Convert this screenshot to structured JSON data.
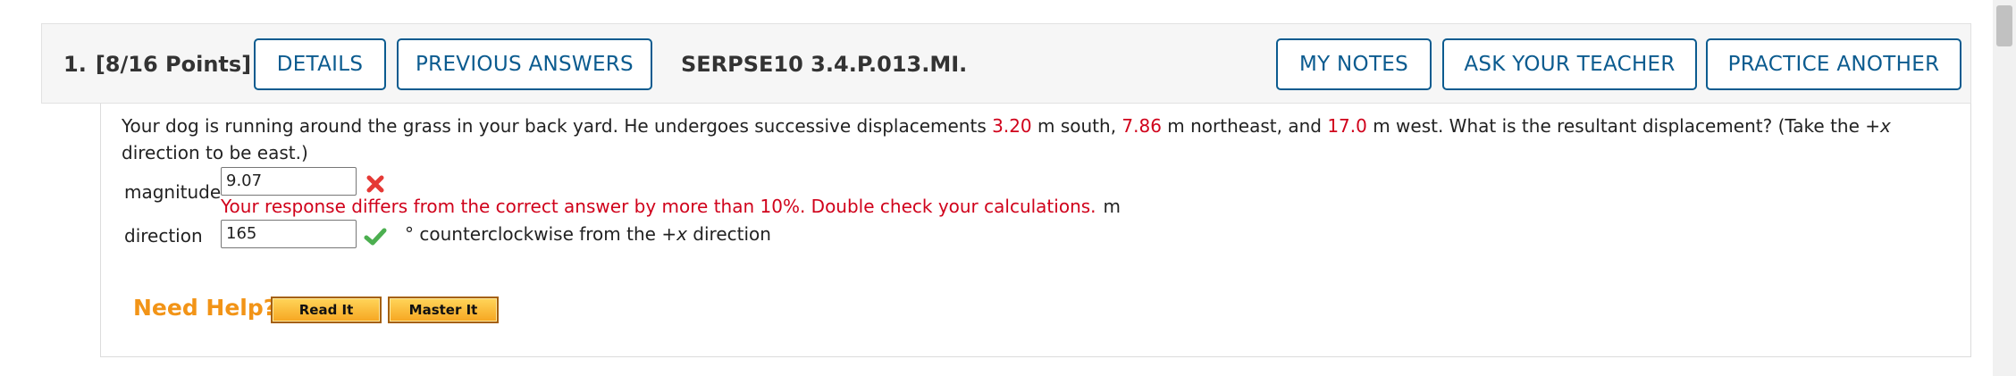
{
  "question": {
    "number": "1.",
    "points": "[8/16 Points]",
    "code": "SERPSE10 3.4.P.013.MI.",
    "buttons": {
      "details": "DETAILS",
      "previous_answers": "PREVIOUS ANSWERS",
      "my_notes": "MY NOTES",
      "ask_teacher": "ASK YOUR TEACHER",
      "practice_another": "PRACTICE ANOTHER"
    },
    "prompt": {
      "part1": "Your dog is running around the grass in your back yard. He undergoes successive displacements ",
      "d1": "3.20",
      "part2": " m south, ",
      "d2": "7.86",
      "part3": " m northeast, and ",
      "d3": "17.0",
      "part4": " m west. What is the resultant displacement? (Take the +",
      "x": "x",
      "part5": " direction to be east.)"
    },
    "magnitude": {
      "label": "magnitude",
      "value": "9.07",
      "status": "incorrect",
      "feedback": "Your response differs from the correct answer by more than 10%. Double check your calculations.",
      "unit": "m"
    },
    "direction": {
      "label": "direction",
      "value": "165",
      "status": "correct",
      "unit_pre": "° counterclockwise from the +",
      "x": "x",
      "unit_post": " direction"
    },
    "help": {
      "label": "Need Help?",
      "read_it": "Read It",
      "master_it": "Master It"
    }
  },
  "colors": {
    "accent_blue": "#0b5b8f",
    "error_red": "#d0021b",
    "correct_green": "#4caf50",
    "help_orange": "#f29417"
  }
}
